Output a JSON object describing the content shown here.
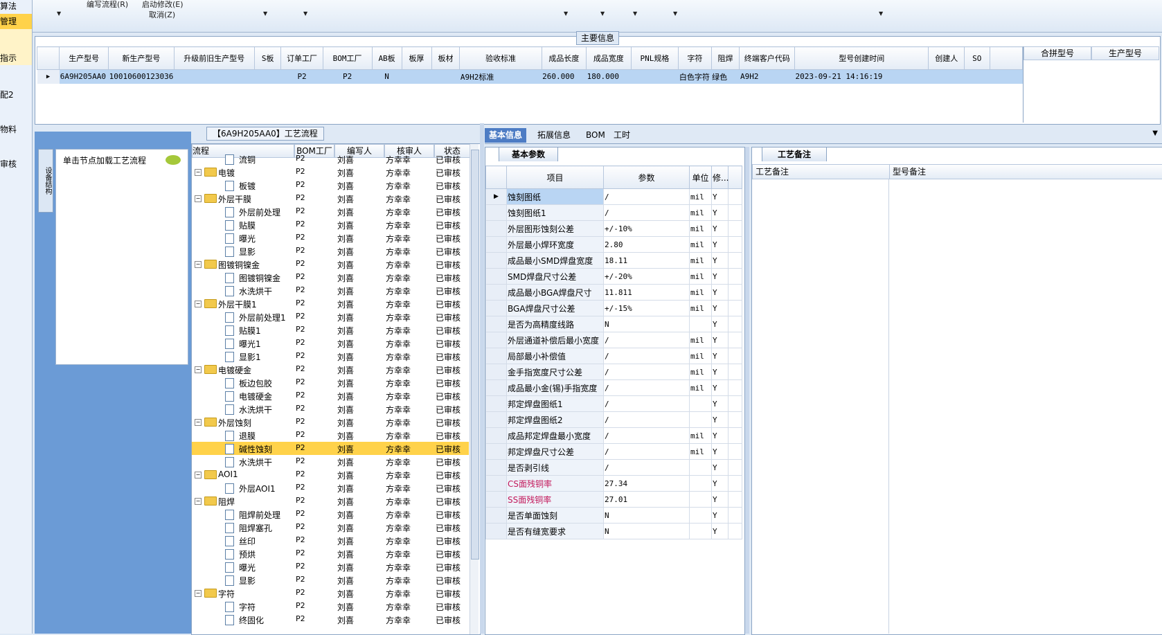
{
  "left_strip": {
    "items": [
      "算法",
      "管理",
      "指示",
      "",
      "配2",
      "",
      "物料",
      "",
      "审核"
    ]
  },
  "toolbar": {
    "menu_flow": "编写流程(R)",
    "menu_start": "启动修改(E)",
    "menu_cancel": "取消(Z)"
  },
  "main_info": {
    "title": "主要信息",
    "columns": [
      "生产型号",
      "新生产型号",
      "升级前旧生产型号",
      "S板",
      "订单工厂",
      "BOM工厂",
      "AB板",
      "板厚",
      "板材",
      "验收标准",
      "成品长度",
      "成品宽度",
      "PNL规格",
      "字符",
      "阻焊",
      "终端客户代码",
      "型号创建时间",
      "创建人",
      "SO"
    ],
    "row": {
      "model": "6A9H205AA0",
      "new_model": "10010600123036",
      "old_model": "",
      "s_board": "",
      "order_factory": "P2",
      "bom_factory": "P2",
      "ab_board": "N",
      "thickness": "",
      "material": "",
      "standard": "A9H2标准",
      "length": "260.000",
      "width": "180.000",
      "pnl": "",
      "char": "白色字符",
      "solder": "绿色",
      "customer": "A9H2",
      "created": "2023-09-21 14:16:19",
      "creator": "",
      "so": ""
    },
    "side_columns": [
      "合拼型号",
      "生产型号"
    ]
  },
  "left_panel": {
    "vtab": "设备结构",
    "click_hint": "单击节点加载工艺流程"
  },
  "flow": {
    "title": "【6A9H205AA0】工艺流程",
    "columns": [
      "流程",
      "BOM工厂",
      "编写人",
      "核审人",
      "状态"
    ],
    "rows": [
      {
        "name": "流铜",
        "level": 2,
        "bom": "P2",
        "writer": "刘喜",
        "reviewer": "方幸幸",
        "status": "已审核"
      },
      {
        "name": "电镀",
        "level": 1,
        "bom": "P2",
        "writer": "刘喜",
        "reviewer": "方幸幸",
        "status": "已审核"
      },
      {
        "name": "板镀",
        "level": 2,
        "bom": "P2",
        "writer": "刘喜",
        "reviewer": "方幸幸",
        "status": "已审核"
      },
      {
        "name": "外层干膜",
        "level": 1,
        "bom": "P2",
        "writer": "刘喜",
        "reviewer": "方幸幸",
        "status": "已审核"
      },
      {
        "name": "外层前处理",
        "level": 2,
        "bom": "P2",
        "writer": "刘喜",
        "reviewer": "方幸幸",
        "status": "已审核"
      },
      {
        "name": "贴膜",
        "level": 2,
        "bom": "P2",
        "writer": "刘喜",
        "reviewer": "方幸幸",
        "status": "已审核"
      },
      {
        "name": "曝光",
        "level": 2,
        "bom": "P2",
        "writer": "刘喜",
        "reviewer": "方幸幸",
        "status": "已审核"
      },
      {
        "name": "显影",
        "level": 2,
        "bom": "P2",
        "writer": "刘喜",
        "reviewer": "方幸幸",
        "status": "已审核"
      },
      {
        "name": "图镀铜镍金",
        "level": 1,
        "bom": "P2",
        "writer": "刘喜",
        "reviewer": "方幸幸",
        "status": "已审核"
      },
      {
        "name": "图镀铜镍金",
        "level": 2,
        "bom": "P2",
        "writer": "刘喜",
        "reviewer": "方幸幸",
        "status": "已审核"
      },
      {
        "name": "水洗烘干",
        "level": 2,
        "bom": "P2",
        "writer": "刘喜",
        "reviewer": "方幸幸",
        "status": "已审核"
      },
      {
        "name": "外层干膜1",
        "level": 1,
        "bom": "P2",
        "writer": "刘喜",
        "reviewer": "方幸幸",
        "status": "已审核"
      },
      {
        "name": "外层前处理1",
        "level": 2,
        "bom": "P2",
        "writer": "刘喜",
        "reviewer": "方幸幸",
        "status": "已审核"
      },
      {
        "name": "贴膜1",
        "level": 2,
        "bom": "P2",
        "writer": "刘喜",
        "reviewer": "方幸幸",
        "status": "已审核"
      },
      {
        "name": "曝光1",
        "level": 2,
        "bom": "P2",
        "writer": "刘喜",
        "reviewer": "方幸幸",
        "status": "已审核"
      },
      {
        "name": "显影1",
        "level": 2,
        "bom": "P2",
        "writer": "刘喜",
        "reviewer": "方幸幸",
        "status": "已审核"
      },
      {
        "name": "电镀硬金",
        "level": 1,
        "bom": "P2",
        "writer": "刘喜",
        "reviewer": "方幸幸",
        "status": "已审核"
      },
      {
        "name": "板边包胶",
        "level": 2,
        "bom": "P2",
        "writer": "刘喜",
        "reviewer": "方幸幸",
        "status": "已审核"
      },
      {
        "name": "电镀硬金",
        "level": 2,
        "bom": "P2",
        "writer": "刘喜",
        "reviewer": "方幸幸",
        "status": "已审核"
      },
      {
        "name": "水洗烘干",
        "level": 2,
        "bom": "P2",
        "writer": "刘喜",
        "reviewer": "方幸幸",
        "status": "已审核"
      },
      {
        "name": "外层蚀刻",
        "level": 1,
        "bom": "P2",
        "writer": "刘喜",
        "reviewer": "方幸幸",
        "status": "已审核"
      },
      {
        "name": "退膜",
        "level": 2,
        "bom": "P2",
        "writer": "刘喜",
        "reviewer": "方幸幸",
        "status": "已审核"
      },
      {
        "name": "碱性蚀刻",
        "level": 2,
        "bom": "P2",
        "writer": "刘喜",
        "reviewer": "方幸幸",
        "status": "已审核",
        "selected": true
      },
      {
        "name": "水洗烘干",
        "level": 2,
        "bom": "P2",
        "writer": "刘喜",
        "reviewer": "方幸幸",
        "status": "已审核"
      },
      {
        "name": "AOI1",
        "level": 1,
        "bom": "P2",
        "writer": "刘喜",
        "reviewer": "方幸幸",
        "status": "已审核"
      },
      {
        "name": "外层AOI1",
        "level": 2,
        "bom": "P2",
        "writer": "刘喜",
        "reviewer": "方幸幸",
        "status": "已审核"
      },
      {
        "name": "阻焊",
        "level": 1,
        "bom": "P2",
        "writer": "刘喜",
        "reviewer": "方幸幸",
        "status": "已审核"
      },
      {
        "name": "阻焊前处理",
        "level": 2,
        "bom": "P2",
        "writer": "刘喜",
        "reviewer": "方幸幸",
        "status": "已审核"
      },
      {
        "name": "阻焊塞孔",
        "level": 2,
        "bom": "P2",
        "writer": "刘喜",
        "reviewer": "方幸幸",
        "status": "已审核"
      },
      {
        "name": "丝印",
        "level": 2,
        "bom": "P2",
        "writer": "刘喜",
        "reviewer": "方幸幸",
        "status": "已审核"
      },
      {
        "name": "预烘",
        "level": 2,
        "bom": "P2",
        "writer": "刘喜",
        "reviewer": "方幸幸",
        "status": "已审核"
      },
      {
        "name": "曝光",
        "level": 2,
        "bom": "P2",
        "writer": "刘喜",
        "reviewer": "方幸幸",
        "status": "已审核"
      },
      {
        "name": "显影",
        "level": 2,
        "bom": "P2",
        "writer": "刘喜",
        "reviewer": "方幸幸",
        "status": "已审核"
      },
      {
        "name": "字符",
        "level": 1,
        "bom": "P2",
        "writer": "刘喜",
        "reviewer": "方幸幸",
        "status": "已审核"
      },
      {
        "name": "字符",
        "level": 2,
        "bom": "P2",
        "writer": "刘喜",
        "reviewer": "方幸幸",
        "status": "已审核"
      },
      {
        "name": "终固化",
        "level": 2,
        "bom": "P2",
        "writer": "刘喜",
        "reviewer": "方幸幸",
        "status": "已审核"
      }
    ]
  },
  "tabs": [
    "基本信息",
    "拓展信息",
    "BOM",
    "工时"
  ],
  "basic": {
    "subtab": "基本参数",
    "columns": [
      "项目",
      "参数",
      "单位",
      "修..."
    ],
    "rows": [
      {
        "item": "蚀刻图纸",
        "value": "/",
        "unit": "mil",
        "flag": "Y",
        "pink": false
      },
      {
        "item": "蚀刻图纸1",
        "value": "/",
        "unit": "mil",
        "flag": "Y",
        "pink": false
      },
      {
        "item": "外层图形蚀刻公差",
        "value": "+/-10%",
        "unit": "mil",
        "flag": "Y",
        "pink": false
      },
      {
        "item": "外层最小焊环宽度",
        "value": "2.80",
        "unit": "mil",
        "flag": "Y",
        "pink": false
      },
      {
        "item": "成品最小SMD焊盘宽度",
        "value": "18.11",
        "unit": "mil",
        "flag": "Y",
        "pink": false
      },
      {
        "item": "SMD焊盘尺寸公差",
        "value": "+/-20%",
        "unit": "mil",
        "flag": "Y",
        "pink": false
      },
      {
        "item": "成品最小BGA焊盘尺寸",
        "value": "11.811",
        "unit": "mil",
        "flag": "Y",
        "pink": false
      },
      {
        "item": "BGA焊盘尺寸公差",
        "value": "+/-15%",
        "unit": "mil",
        "flag": "Y",
        "pink": false
      },
      {
        "item": "是否为高精度线路",
        "value": "N",
        "unit": "",
        "flag": "Y",
        "pink": false
      },
      {
        "item": "外层通道补偿后最小宽度",
        "value": "/",
        "unit": "mil",
        "flag": "Y",
        "pink": false
      },
      {
        "item": "局部最小补偿值",
        "value": "/",
        "unit": "mil",
        "flag": "Y",
        "pink": false
      },
      {
        "item": "金手指宽度尺寸公差",
        "value": "/",
        "unit": "mil",
        "flag": "Y",
        "pink": false
      },
      {
        "item": "成品最小金(锡)手指宽度",
        "value": "/",
        "unit": "mil",
        "flag": "Y",
        "pink": false
      },
      {
        "item": "邦定焊盘图纸1",
        "value": "/",
        "unit": "",
        "flag": "Y",
        "pink": false
      },
      {
        "item": "邦定焊盘图纸2",
        "value": "/",
        "unit": "",
        "flag": "Y",
        "pink": false
      },
      {
        "item": "成品邦定焊盘最小宽度",
        "value": "/",
        "unit": "mil",
        "flag": "Y",
        "pink": false
      },
      {
        "item": "邦定焊盘尺寸公差",
        "value": "/",
        "unit": "mil",
        "flag": "Y",
        "pink": false
      },
      {
        "item": "是否剥引线",
        "value": "/",
        "unit": "",
        "flag": "Y",
        "pink": false
      },
      {
        "item": "CS面残铜率",
        "value": "27.34",
        "unit": "",
        "flag": "Y",
        "pink": true
      },
      {
        "item": "SS面残铜率",
        "value": "27.01",
        "unit": "",
        "flag": "Y",
        "pink": true
      },
      {
        "item": "是否单面蚀刻",
        "value": "N",
        "unit": "",
        "flag": "Y",
        "pink": false
      },
      {
        "item": "是否有缝宽要求",
        "value": "N",
        "unit": "",
        "flag": "Y",
        "pink": false
      }
    ]
  },
  "remarks": {
    "tab": "工艺备注",
    "columns": [
      "工艺备注",
      "型号备注"
    ]
  }
}
